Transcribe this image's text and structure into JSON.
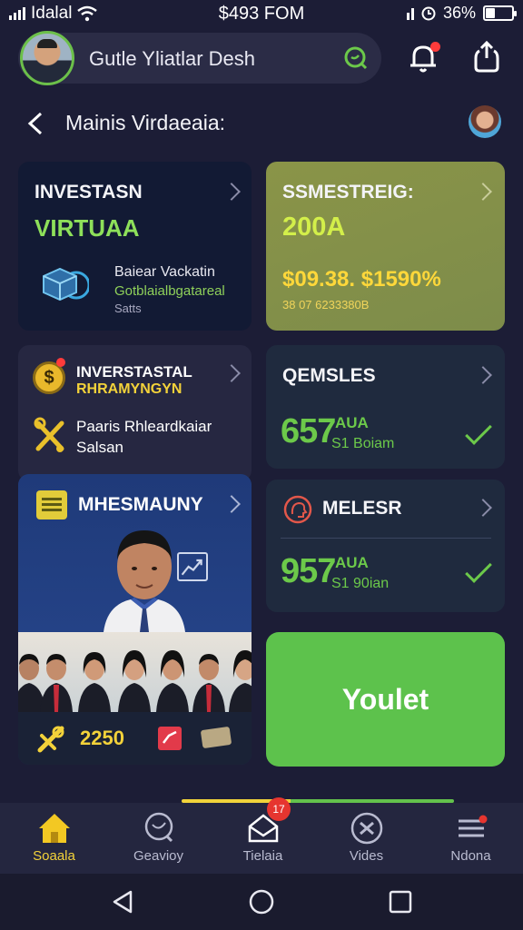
{
  "status_bar": {
    "carrier": "Idalal",
    "time": "$493 FOM",
    "battery_percent": "36%",
    "battery_level": 0.36
  },
  "header": {
    "title": "Gutle Yliatlar Desh"
  },
  "subheader": {
    "title": "Mainis Virdaeaia:"
  },
  "cards": {
    "investment": {
      "title": "INVESTASN",
      "subtitle": "VIRTUAA",
      "line1": "Baiear Vackatin",
      "line2": "Gotblaialbgatareal",
      "line3": "Satts"
    },
    "semester": {
      "title": "SSMESTREIG:",
      "value": "200A",
      "figures": "$09.38. $1590%",
      "small": "38 07 6233380B"
    },
    "investatal": {
      "title": "INVERSTASTAL",
      "subtitle": "RHRAMYNGYN",
      "line1": "Paaris Rhleardkaiar",
      "line2": "Salsan",
      "coin_symbol": "$"
    },
    "qemsles": {
      "title": "QEMSLES",
      "big_value": "657",
      "unit": "AUA",
      "note": "S1 Boiam"
    },
    "melesr": {
      "title": "MELESR",
      "big_value": "957",
      "unit": "AUA",
      "note": "S1 90ian"
    },
    "mhesmauny": {
      "title": "MHESMAUNY",
      "value": "2250"
    }
  },
  "cta": {
    "label": "Youlet"
  },
  "bottom_nav": {
    "items": [
      {
        "label": "Soaala",
        "icon": "home-icon"
      },
      {
        "label": "Geavioy",
        "icon": "search-icon"
      },
      {
        "label": "Tielaia",
        "icon": "mail-icon",
        "badge": "17"
      },
      {
        "label": "Vides",
        "icon": "tools-icon"
      },
      {
        "label": "Ndona",
        "icon": "menu-icon"
      }
    ]
  },
  "colors": {
    "accent_green": "#5dc24c",
    "accent_yellow": "#f3d23a",
    "background": "#1c1d36"
  }
}
